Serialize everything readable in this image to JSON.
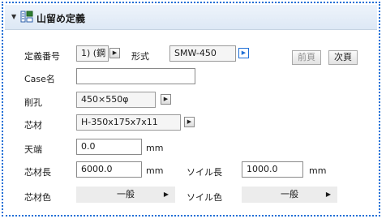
{
  "title": "山留め定義",
  "definition": {
    "number_label": "定義番号",
    "number_value": "1) (鋼",
    "format_label": "形式",
    "format_value": "SMW-450",
    "prev_label": "前頁",
    "next_label": "次頁"
  },
  "case": {
    "label": "Case名",
    "value": ""
  },
  "hole": {
    "label": "削孔",
    "value": "450×550φ"
  },
  "core": {
    "label": "芯材",
    "value": "H-350x175x7x11"
  },
  "top": {
    "label": "天端",
    "value": "0.0",
    "unit": "mm"
  },
  "core_length": {
    "label": "芯材長",
    "value": "6000.0",
    "unit": "mm"
  },
  "soil_length": {
    "label": "ソイル長",
    "value": "1000.0",
    "unit": "mm"
  },
  "core_color": {
    "label": "芯材色",
    "value": "一般"
  },
  "soil_color": {
    "label": "ソイル色",
    "value": "一般"
  },
  "colors": {
    "accent": "#1f6fd6",
    "header_bg": "#dde8f5"
  }
}
